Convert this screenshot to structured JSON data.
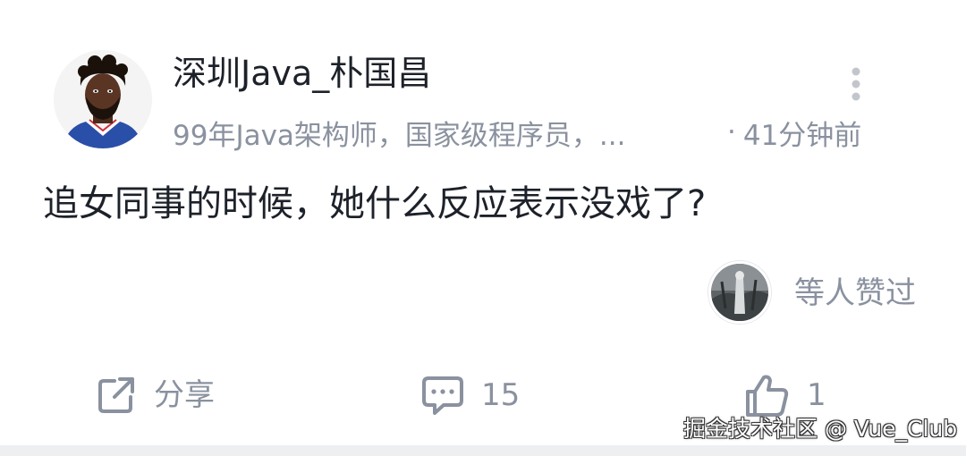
{
  "post": {
    "author": {
      "name": "深圳Java_朴国昌",
      "bio": "99年Java架构师，国家级程序员，...",
      "separator": "·",
      "time": "41分钟前",
      "avatar_icon": "author-avatar"
    },
    "content": "追女同事的时候，她什么反应表示没戏了?",
    "likes_summary": {
      "text": "等人赞过",
      "avatar_icon": "liker-avatar"
    },
    "more_icon": "more-vertical-icon"
  },
  "actions": {
    "share": {
      "label": "分享",
      "icon": "share-icon"
    },
    "comment": {
      "count": "15",
      "icon": "comment-icon"
    },
    "like": {
      "count": "1",
      "icon": "thumbs-up-icon"
    }
  },
  "watermark": "掘金技术社区 @ Vue_Club",
  "colors": {
    "text_primary": "#1d2129",
    "text_secondary": "#8a919f",
    "card_background": "#ffffff",
    "page_background": "#eeeff1"
  }
}
